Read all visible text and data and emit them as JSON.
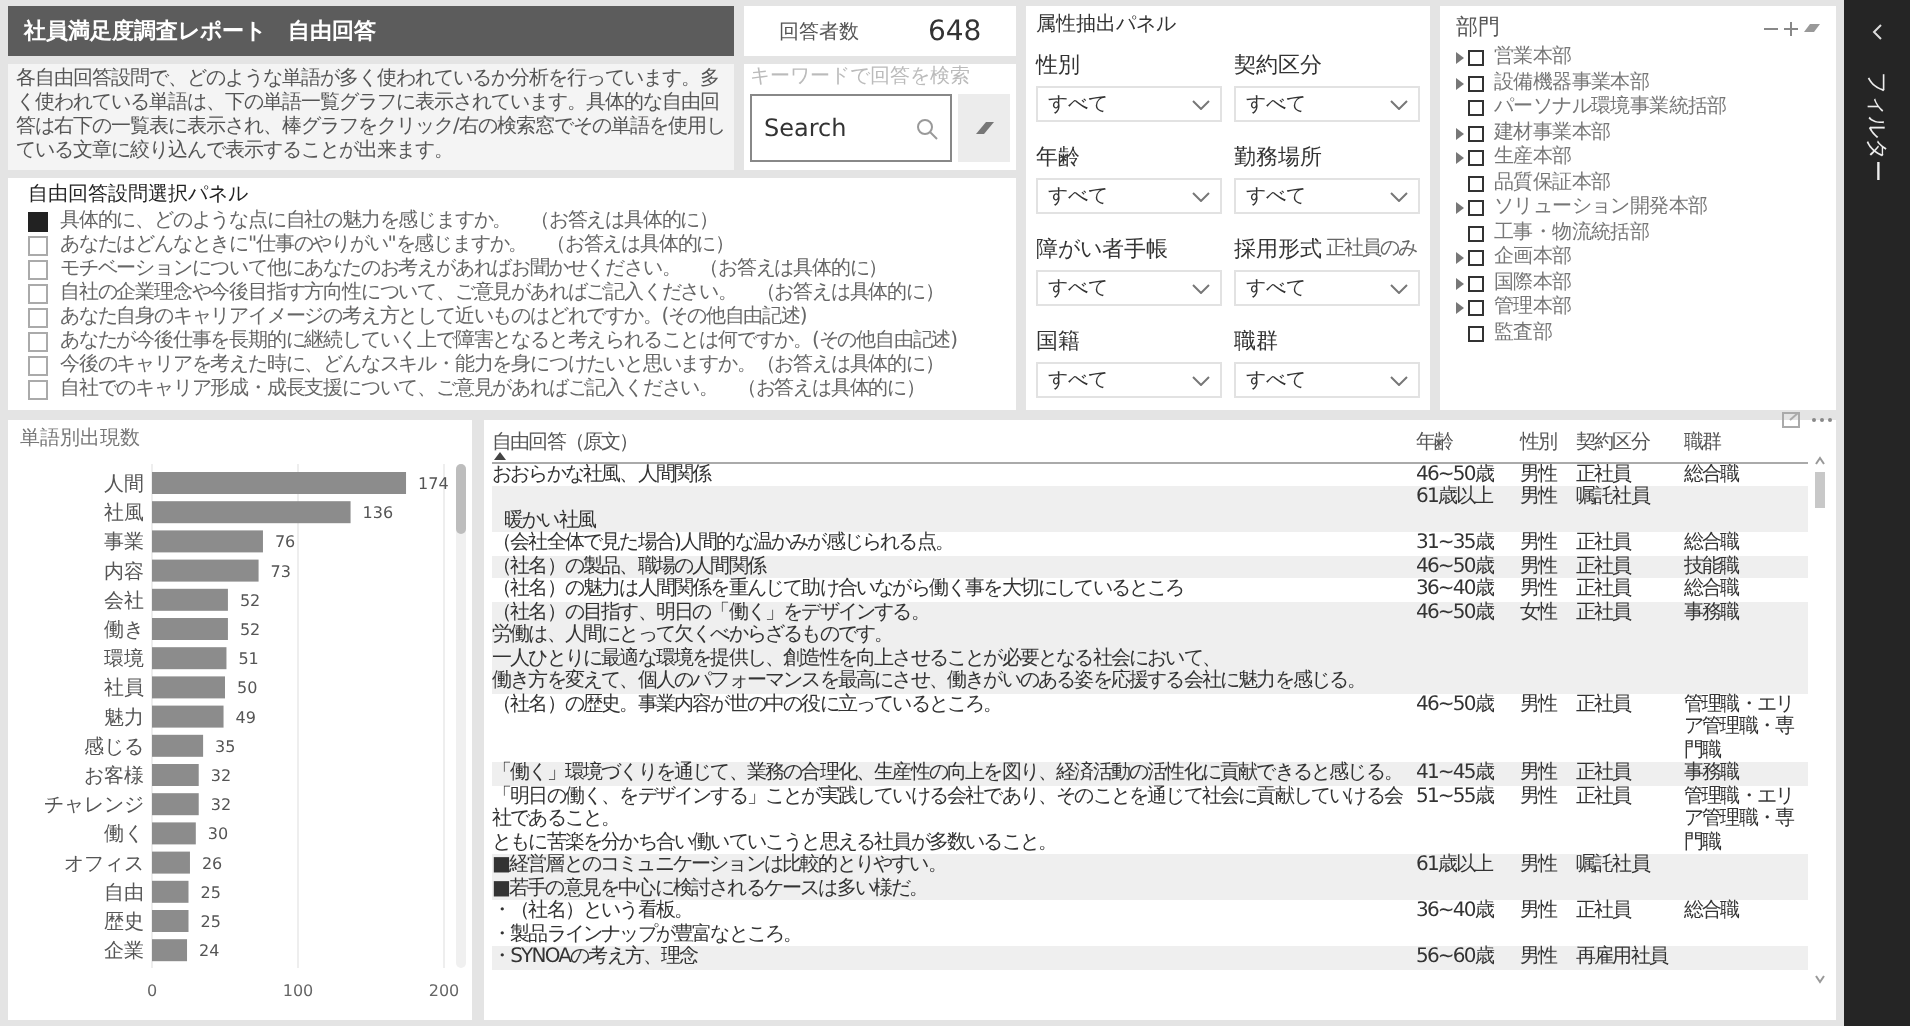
{
  "header": {
    "title": "社員満足度調査レポート　自由回答"
  },
  "respondents": {
    "label": "回答者数",
    "value": "648"
  },
  "description": "各自由回答設問で、どのような単語が多く使われているか分析を行っています。多く使われている単語は、下の単語一覧グラフに表示されています。具体的な自由回答は右下の一覧表に表示され、棒グラフをクリック/右の検索窓でその単語を使用している文章に絞り込んで表示することが出来ます。",
  "search": {
    "label": "キーワードで回答を検索",
    "placeholder": "Search"
  },
  "question_panel": {
    "title": "自由回答設問選択パネル",
    "items": [
      {
        "text": "具体的に、どのような点に自社の魅力を感じますか。　（お答えは具体的に）",
        "checked": true
      },
      {
        "text": "あなたはどんなときに\"仕事のやりがい\"を感じますか。　（お答えは具体的に）",
        "checked": false
      },
      {
        "text": "モチベーションについて他にあなたのお考えがあればお聞かせください。　（お答えは具体的に）",
        "checked": false
      },
      {
        "text": "自社の企業理念や今後目指す方向性について、ご意見があればご記入ください。　（お答えは具体的に）",
        "checked": false
      },
      {
        "text": "あなた自身のキャリアイメージの考え方として近いものはどれですか。(その他自由記述)",
        "checked": false
      },
      {
        "text": "あなたが今後仕事を長期的に継続していく上で障害となると考えられることは何ですか。(その他自由記述)",
        "checked": false
      },
      {
        "text": "今後のキャリアを考えた時に、どんなスキル・能力を身につけたいと思いますか。（お答えは具体的に）",
        "checked": false
      },
      {
        "text": "自社でのキャリア形成・成長支援について、ご意見があればご記入ください。　（お答えは具体的に）",
        "checked": false
      }
    ]
  },
  "attribute_panel": {
    "title": "属性抽出パネル",
    "filters": [
      {
        "label": "性別",
        "value": "すべて"
      },
      {
        "label": "契約区分",
        "value": "すべて"
      },
      {
        "label": "年齢",
        "value": "すべて"
      },
      {
        "label": "勤務場所",
        "value": "すべて"
      },
      {
        "label": "障がい者手帳",
        "value": "すべて"
      },
      {
        "label": "採用形式",
        "note": "正社員のみ",
        "value": "すべて"
      },
      {
        "label": "国籍",
        "value": "すべて"
      },
      {
        "label": "職群",
        "value": "すべて"
      }
    ]
  },
  "department_panel": {
    "title": "部門",
    "items": [
      {
        "label": "営業本部",
        "expandable": true,
        "checked": false
      },
      {
        "label": "設備機器事業本部",
        "expandable": true,
        "checked": false
      },
      {
        "label": "パーソナル環境事業統括部",
        "expandable": false,
        "checked": false
      },
      {
        "label": "建材事業本部",
        "expandable": true,
        "checked": false
      },
      {
        "label": "生産本部",
        "expandable": true,
        "checked": false
      },
      {
        "label": "品質保証本部",
        "expandable": false,
        "checked": false
      },
      {
        "label": "ソリューション開発本部",
        "expandable": true,
        "checked": false
      },
      {
        "label": "工事・物流統括部",
        "expandable": false,
        "checked": false
      },
      {
        "label": "企画本部",
        "expandable": true,
        "checked": false
      },
      {
        "label": "国際本部",
        "expandable": true,
        "checked": false
      },
      {
        "label": "管理本部",
        "expandable": true,
        "checked": false
      },
      {
        "label": "監査部",
        "expandable": false,
        "checked": false
      }
    ]
  },
  "word_chart": {
    "chart_data": {
      "type": "bar",
      "orientation": "horizontal",
      "title": "単語別出現数",
      "categories": [
        "人間",
        "社風",
        "事業",
        "内容",
        "会社",
        "働き",
        "環境",
        "社員",
        "魅力",
        "感じる",
        "お客様",
        "チャレンジ",
        "働く",
        "オフィス",
        "自由",
        "歴史",
        "企業"
      ],
      "values": [
        174,
        136,
        76,
        73,
        52,
        52,
        51,
        50,
        49,
        35,
        32,
        32,
        30,
        26,
        25,
        25,
        24
      ],
      "xlim": [
        0,
        200
      ],
      "xticks": [
        0,
        100,
        200
      ],
      "data_labels": true
    }
  },
  "answers_table": {
    "columns": [
      "自由回答（原文）",
      "年齢",
      "性別",
      "契約区分",
      "職群"
    ],
    "rows": [
      {
        "answer": [
          "おおらかな社風、人間関係"
        ],
        "age": "46~50歳",
        "gender": "男性",
        "contract": "正社員",
        "job_group": "総合職"
      },
      {
        "answer": [
          "暖かい社風"
        ],
        "leading_blank": true,
        "age": "61歳以上",
        "gender": "男性",
        "contract": "嘱託社員"
      },
      {
        "answer": [
          "（会社全体で見た場合)人間的な温かみが感じられる点。"
        ],
        "age": "31~35歳",
        "gender": "男性",
        "contract": "正社員",
        "job_group": "総合職"
      },
      {
        "answer": [
          "（社名）の製品、職場の人間関係"
        ],
        "age": "46~50歳",
        "gender": "男性",
        "contract": "正社員",
        "job_group": "技能職"
      },
      {
        "answer": [
          "（社名）の魅力は人間関係を重んじて助け合いながら働く事を大切にしているところ"
        ],
        "age": "36~40歳",
        "gender": "男性",
        "contract": "正社員",
        "job_group": "総合職"
      },
      {
        "answer": [
          "（社名）の目指す、明日の「働く」をデザインする。",
          "労働は、人間にとって欠くべからざるものです。",
          "一人ひとりに最適な環境を提供し、創造性を向上させることが必要となる社会において、",
          "働き方を変えて、個人のパフォーマンスを最高にさせ、働きがいのある姿を応援する会社に魅力を感じる。"
        ],
        "age": "46~50歳",
        "gender": "女性",
        "contract": "正社員",
        "job_group": "事務職"
      },
      {
        "answer": [
          "（社名）の歴史。事業内容が世の中の役に立っているところ。"
        ],
        "age": "46~50歳",
        "gender": "男性",
        "contract": "正社員",
        "job_group": "管理職・エリア管理職・専門職"
      },
      {
        "answer": [
          "「働く」環境づくりを通じて、業務の合理化、生産性の向上を図り、経済活動の活性化に貢献できると感じる。"
        ],
        "age": "41~45歳",
        "gender": "男性",
        "contract": "正社員",
        "job_group": "事務職"
      },
      {
        "answer": [
          "「明日の働く、をデザインする」ことが実践していける会社であり、そのことを通じて社会に貢献していける会社であること。",
          "ともに苦楽を分かち合い働いていこうと思える社員が多数いること。"
        ],
        "age": "51~55歳",
        "gender": "男性",
        "contract": "正社員",
        "job_group": "管理職・エリア管理職・専門職"
      },
      {
        "answer": [
          "■経営層とのコミュニケーションは比較的とりやすい。",
          "■若手の意見を中心に検討されるケースは多い様だ。"
        ],
        "age": "61歳以上",
        "gender": "男性",
        "contract": "嘱託社員"
      },
      {
        "answer": [
          "・（社名）という看板。",
          "・製品ラインナップが豊富なところ。"
        ],
        "age": "36~40歳",
        "gender": "男性",
        "contract": "正社員",
        "job_group": "総合職"
      },
      {
        "answer": [
          "・SYNOAの考え方、理念"
        ],
        "age": "56~60歳",
        "gender": "男性",
        "contract": "再雇用社員"
      }
    ]
  },
  "filter_pane": {
    "label": "フィルター"
  }
}
